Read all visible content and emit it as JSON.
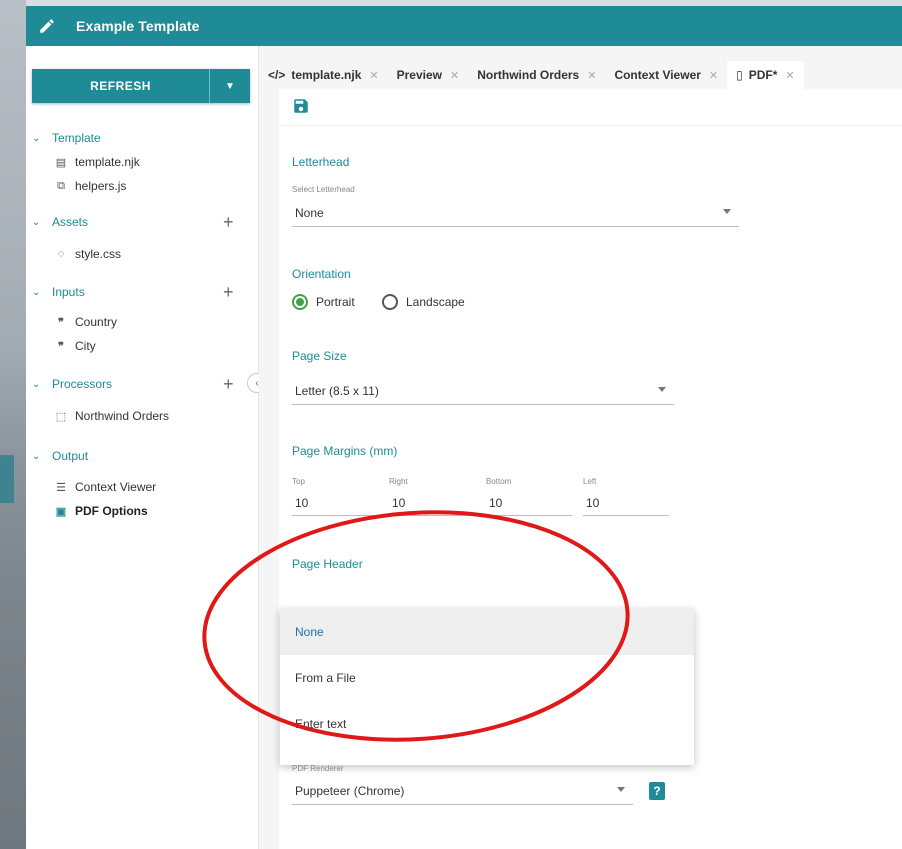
{
  "app": {
    "title": "Example Template",
    "accent": "#1e8b96"
  },
  "sidebar": {
    "refresh_label": "REFRESH",
    "groups": [
      {
        "label": "Template",
        "items": [
          {
            "label": "template.njk",
            "icon": "file-icon"
          },
          {
            "label": "helpers.js",
            "icon": "script-file-icon"
          }
        ]
      },
      {
        "label": "Assets",
        "items": [
          {
            "label": "style.css",
            "icon": "palette-icon"
          }
        ]
      },
      {
        "label": "Inputs",
        "items": [
          {
            "label": "Country",
            "icon": "quote-icon"
          },
          {
            "label": "City",
            "icon": "quote-icon"
          }
        ]
      },
      {
        "label": "Processors",
        "items": [
          {
            "label": "Northwind Orders",
            "icon": "processor-icon"
          }
        ]
      },
      {
        "label": "Output",
        "items": [
          {
            "label": "Context Viewer",
            "icon": "list-icon"
          },
          {
            "label": "PDF Options",
            "icon": "pdf-file-icon"
          }
        ]
      }
    ]
  },
  "tabs": [
    {
      "label": "template.njk",
      "prefix": "</>"
    },
    {
      "label": "Preview"
    },
    {
      "label": "Northwind Orders"
    },
    {
      "label": "Context Viewer"
    },
    {
      "label": "PDF*",
      "active": true
    }
  ],
  "pdf": {
    "letterhead_title": "Letterhead",
    "letterhead_label": "Select Letterhead",
    "letterhead_value": "None",
    "orientation_title": "Orientation",
    "orientation_options": [
      "Portrait",
      "Landscape"
    ],
    "orientation_selected": "Portrait",
    "page_size_title": "Page Size",
    "page_size_value": "Letter (8.5 x 11)",
    "margins_title": "Page Margins (mm)",
    "margins": [
      {
        "label": "Top",
        "value": "10"
      },
      {
        "label": "Right",
        "value": "10"
      },
      {
        "label": "Bottom",
        "value": "10"
      },
      {
        "label": "Left",
        "value": "10"
      }
    ],
    "page_header_title": "Page Header",
    "page_header_options": [
      "None",
      "From a File",
      "Enter text"
    ],
    "page_header_selected": "None",
    "renderer_label": "PDF Renderer",
    "renderer_value": "Puppeteer (Chrome)",
    "help_glyph": "?"
  }
}
